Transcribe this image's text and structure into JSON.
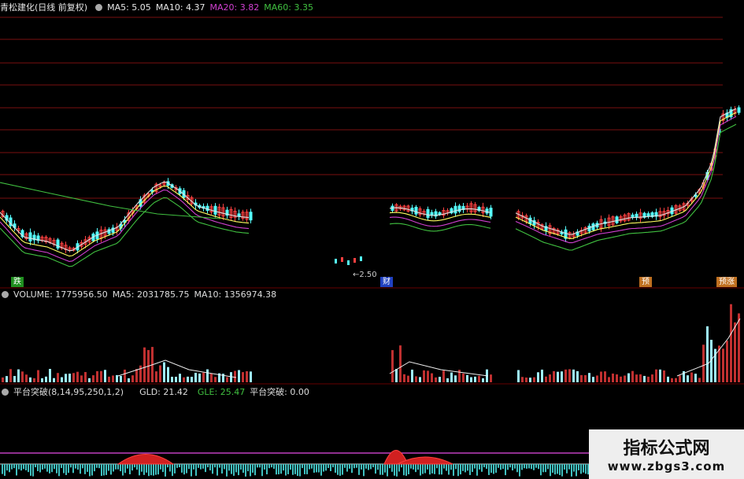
{
  "header": {
    "title": "青松建化(日线 前复权)",
    "ma5": "MA5: 5.05",
    "ma10": "MA10: 4.37",
    "ma20": "MA20: 3.82",
    "ma60": "MA60: 3.35"
  },
  "volume_header": {
    "volume": "VOLUME: 1775956.50",
    "ma5": "MA5: 2031785.75",
    "ma10": "MA10: 1356974.38"
  },
  "indicator_header": {
    "name": "平台突破(8,14,95,250,1,2)",
    "gld": "GLD: 21.42",
    "gle": "GLE: 25.47",
    "break": "平台突破: 0.00"
  },
  "tags": {
    "fall": "跌",
    "finance": "财",
    "forecast": "预",
    "limit_up": "预涨"
  },
  "price_note": "2.50",
  "watermark": {
    "line1": "指标公式网",
    "line2": "www.zbgs3.com"
  },
  "colors": {
    "up": "#ff4040",
    "down": "#54ffff",
    "ma5": "#e0e0e0",
    "ma10": "#ffff60",
    "ma20": "#d040d0",
    "ma60": "#40c040",
    "grid": "#7a1010"
  },
  "chart_data": {
    "type": "candlestick",
    "series": [
      {
        "name": "MA5",
        "value": 5.05
      },
      {
        "name": "MA10",
        "value": 4.37
      },
      {
        "name": "MA20",
        "value": 3.82
      },
      {
        "name": "MA60",
        "value": 3.35
      }
    ],
    "volume": {
      "value": 1775956.5,
      "ma5": 2031785.75,
      "ma10": 1356974.38
    },
    "indicator": {
      "GLD": 21.42,
      "GLE": 25.47,
      "平台突破": 0.0
    },
    "annotation": {
      "label": "2.50"
    }
  }
}
